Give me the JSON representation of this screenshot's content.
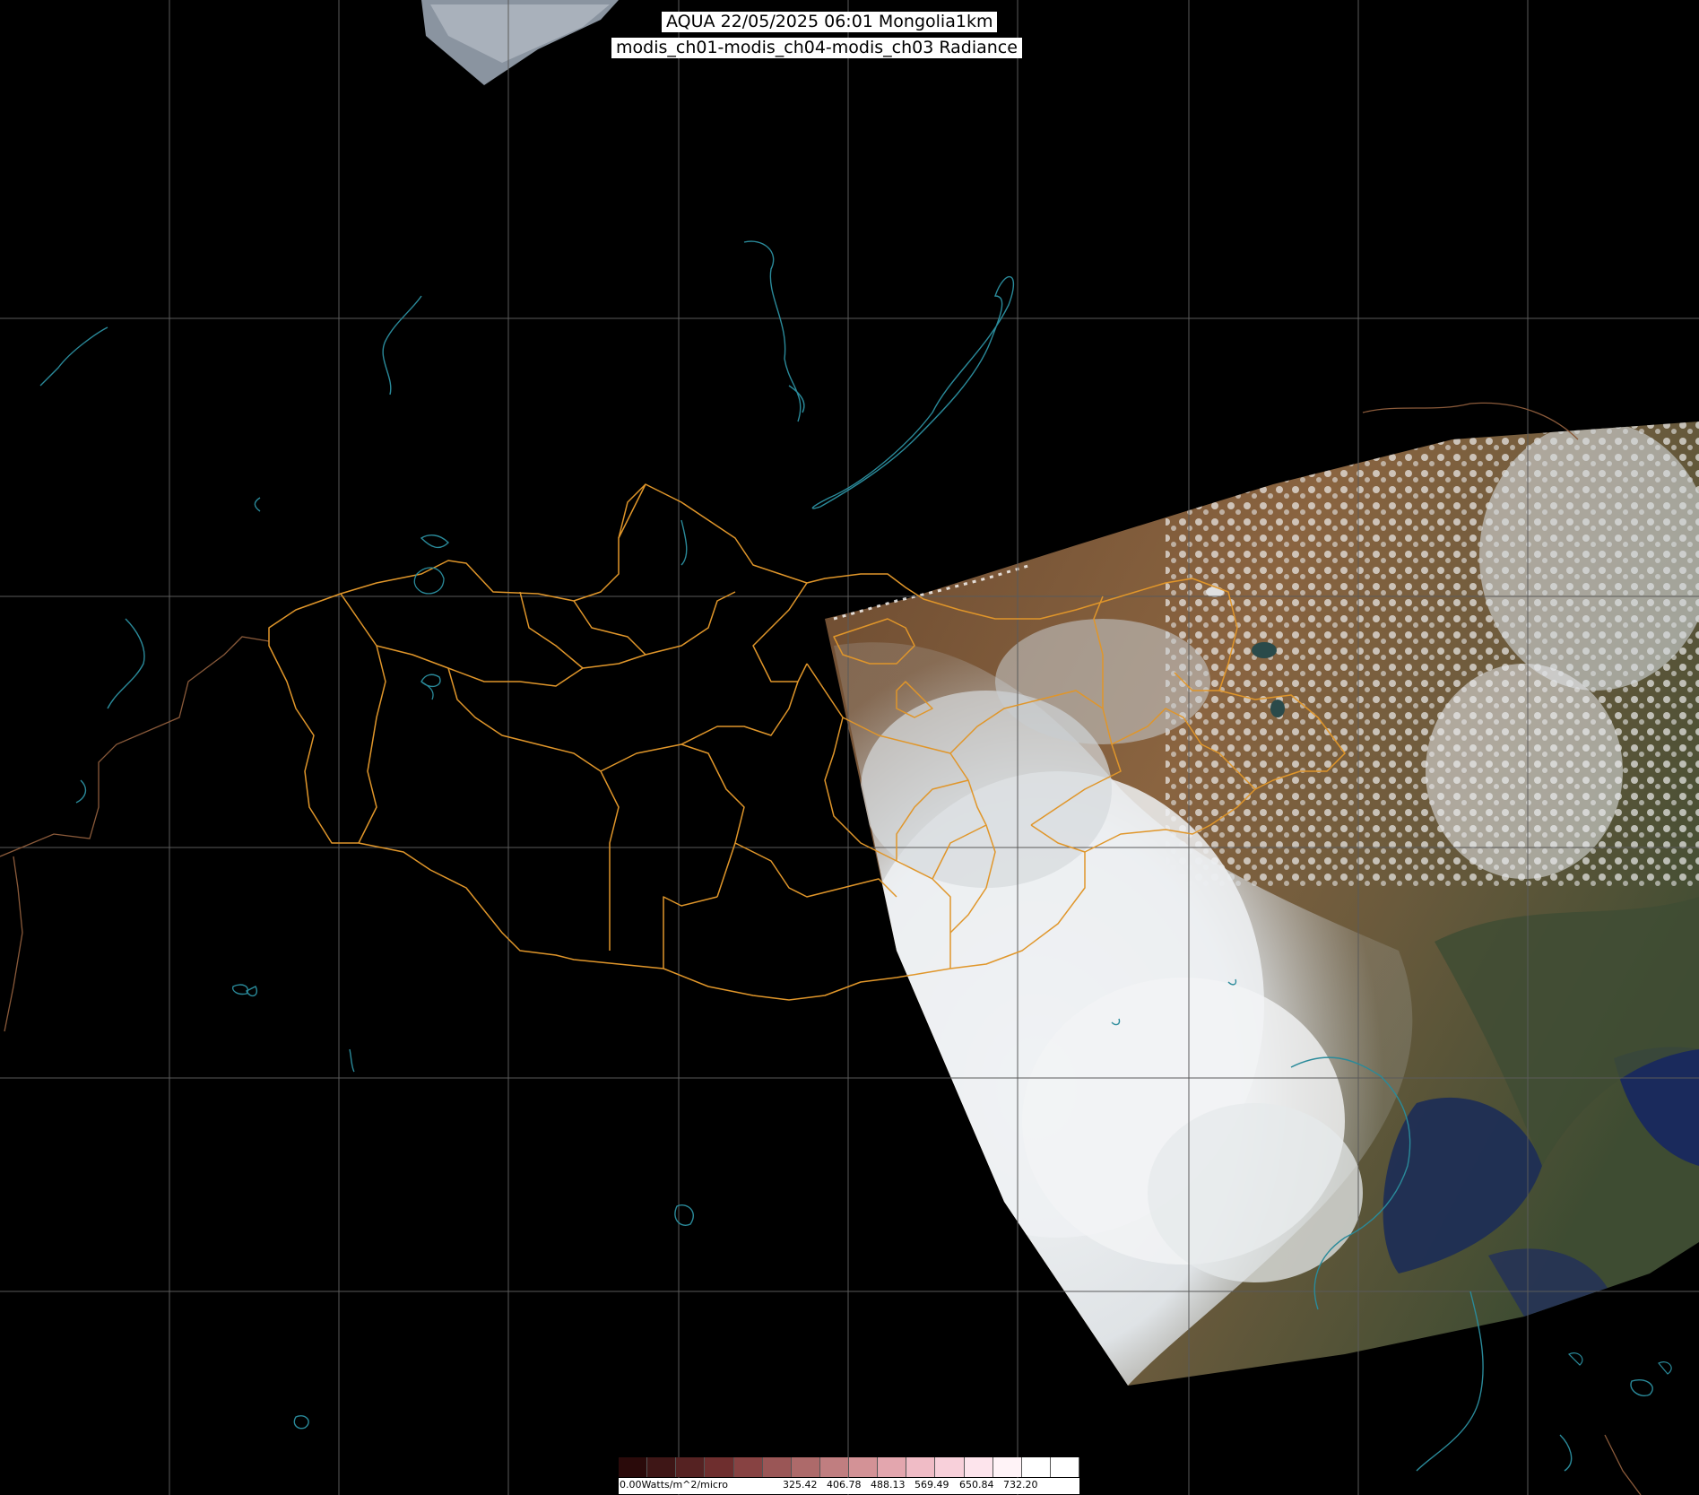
{
  "header": {
    "title_line1": "AQUA 22/05/2025 06:01 Mongolia1km",
    "title_line2": "modis_ch01-modis_ch04-modis_ch03 Radiance"
  },
  "colors": {
    "background": "#000000",
    "graticule": "#5a5a5a",
    "admin_border": "#e0962a",
    "country_border": "#8a5a3a",
    "coastline_water": "#2a8a9a",
    "cloud": "#e8ecef",
    "land_brown": "#7a5a3a",
    "land_green": "#4a5a3a",
    "sea": "#1a2a55"
  },
  "colorbar": {
    "unit_label": "0.00Watts/m^2/micro",
    "tick_labels": [
      "325.42",
      "406.78",
      "488.13",
      "569.49",
      "650.84",
      "732.20"
    ],
    "ramp_colors": [
      "#2a0a0a",
      "#3e1616",
      "#552222",
      "#6e2e2e",
      "#874242",
      "#9a5656",
      "#ad6a6a",
      "#c07e80",
      "#d39296",
      "#e3a6ae",
      "#f0bcc6",
      "#f8d0da",
      "#fde4ec",
      "#fff3f7",
      "#ffffff",
      "#ffffff"
    ]
  }
}
